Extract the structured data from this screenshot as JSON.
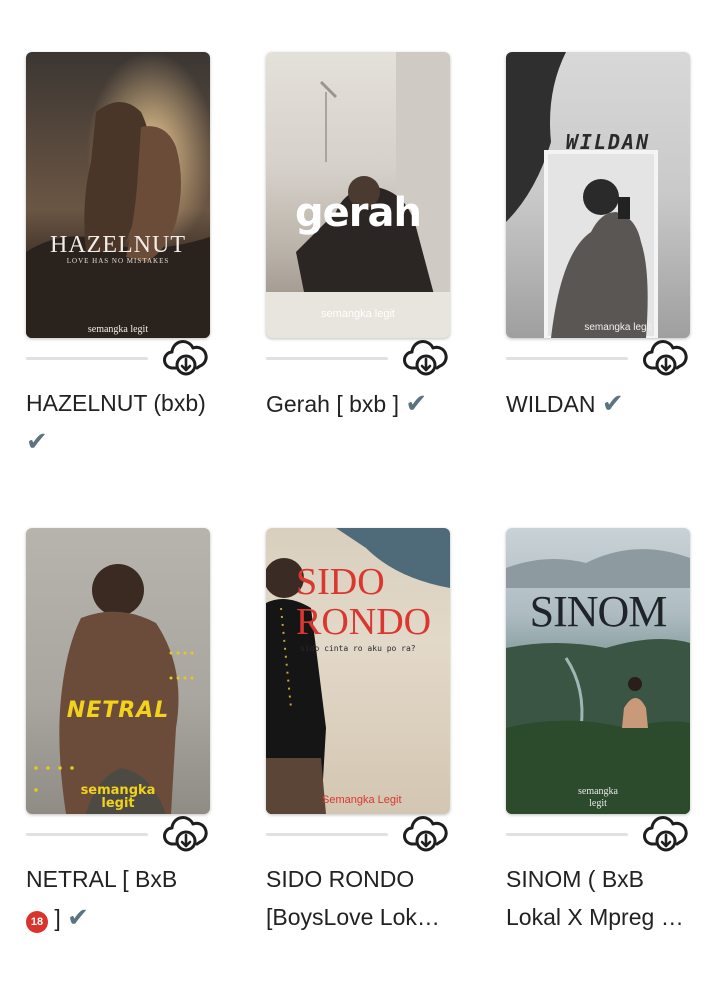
{
  "books": [
    {
      "title": "HAZELNUT (bxb)",
      "title_suffix": "✔",
      "cover_title": "HAZELNUT",
      "cover_subtitle": "LOVE HAS NO MISTAKES",
      "cover_author": "semangka legit",
      "progress_fraction": 0,
      "download_icon": "cloud-download-icon"
    },
    {
      "title": "Gerah [ bxb ]",
      "title_suffix": "✔",
      "cover_title": "gerah",
      "cover_author": "semangka legit",
      "progress_fraction": 0,
      "download_icon": "cloud-download-icon"
    },
    {
      "title": "WILDAN",
      "title_suffix": "✔",
      "cover_title": "WILDAN",
      "cover_author": "semangka legit",
      "progress_fraction": 0,
      "download_icon": "cloud-download-icon"
    },
    {
      "title": "NETRAL [ BxB",
      "title_line2_badge": "🔞",
      "title_line2_text": "]",
      "title_suffix": "✔",
      "cover_title": "NETRAL",
      "cover_author": "semangka legit",
      "progress_fraction": 0,
      "download_icon": "cloud-download-icon"
    },
    {
      "title_line1": "SIDO RONDO",
      "title_line2": "[BoysLove Lok…",
      "cover_title_line1": "SIDO",
      "cover_title_line2": "RONDO",
      "cover_subtitle": "sido cinta ro aku po ra?",
      "cover_author": "Semangka Legit",
      "progress_fraction": 0,
      "download_icon": "cloud-download-icon"
    },
    {
      "title_line1": "SINOM ( BxB",
      "title_line2": "Lokal X Mpreg …",
      "cover_title": "SINOM",
      "cover_author_line1": "semangka",
      "cover_author_line2": "legit",
      "progress_fraction": 0,
      "download_icon": "cloud-download-icon"
    }
  ],
  "colors": {
    "check": "#5e7380",
    "progress_track": "#e1e1e1",
    "badge": "#d9342b"
  }
}
